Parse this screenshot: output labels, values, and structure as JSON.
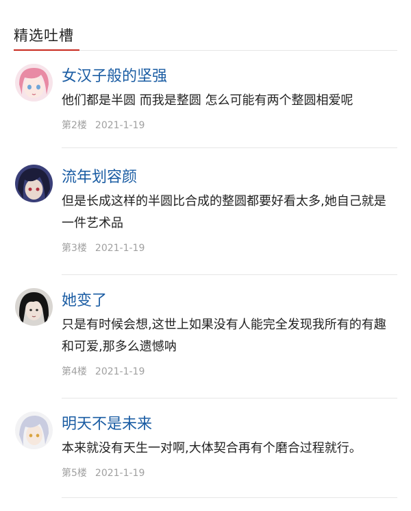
{
  "section": {
    "title": "精选吐槽"
  },
  "comments": [
    {
      "username": "女汉子般的坚强",
      "content": "他们都是半圆 而我是整圆 怎么可能有两个整圆相爱呢",
      "floor": "第2楼",
      "date": "2021-1-19",
      "avatar_icon": "anime-girl-pink-hair-avatar"
    },
    {
      "username": "流年划容颜",
      "content": "但是长成这样的半圆比合成的整圆都要好看太多,她自己就是一件艺术品",
      "floor": "第3楼",
      "date": "2021-1-19",
      "avatar_icon": "anime-dark-hair-avatar"
    },
    {
      "username": "她变了",
      "content": "只是有时候会想,这世上如果没有人能完全发现我所有的有趣和可爱,那多么遗憾呐",
      "floor": "第4楼",
      "date": "2021-1-19",
      "avatar_icon": "girl-dark-hair-avatar"
    },
    {
      "username": "明天不是未来",
      "content": "本来就没有天生一对啊,大体契合再有个磨合过程就行。",
      "floor": "第5楼",
      "date": "2021-1-19",
      "avatar_icon": "anime-silver-hair-avatar"
    }
  ],
  "colors": {
    "username": "#1a5ca3",
    "accent": "#c8281e",
    "meta": "#a0a0a0",
    "text": "#222222",
    "divider": "#e6e6e6"
  }
}
